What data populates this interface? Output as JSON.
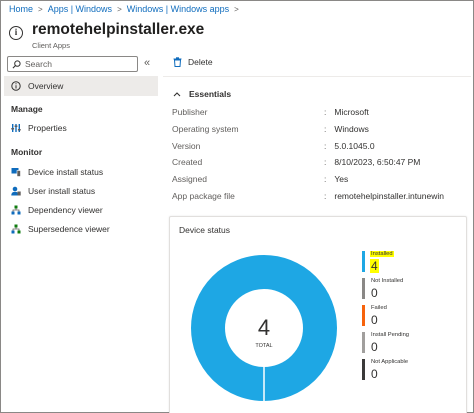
{
  "breadcrumb": [
    "Home",
    "Apps | Windows",
    "Windows | Windows apps"
  ],
  "header": {
    "title": "remotehelpinstaller.exe",
    "subtitle": "Client Apps"
  },
  "search": {
    "placeholder": "Search"
  },
  "sidebar": {
    "overview": "Overview",
    "manage_label": "Manage",
    "properties": "Properties",
    "monitor_label": "Monitor",
    "monitor_items": [
      "Device install status",
      "User install status",
      "Dependency viewer",
      "Supersedence viewer"
    ]
  },
  "toolbar": {
    "delete_label": "Delete"
  },
  "essentials": {
    "heading": "Essentials",
    "rows": [
      {
        "key": "Publisher",
        "value": "Microsoft"
      },
      {
        "key": "Operating system",
        "value": "Windows"
      },
      {
        "key": "Version",
        "value": "5.0.1045.0"
      },
      {
        "key": "Created",
        "value": "8/10/2023, 6:50:47 PM"
      },
      {
        "key": "Assigned",
        "value": "Yes"
      },
      {
        "key": "App package file",
        "value": "remotehelpinstaller.intunewin"
      }
    ]
  },
  "device_status": {
    "title": "Device status",
    "total_value": "4",
    "total_label": "TOTAL",
    "legend": [
      {
        "label": "Installed",
        "value": "4",
        "color": "#1ea7e4",
        "highlight": true
      },
      {
        "label": "Not Installed",
        "value": "0",
        "color": "#8a8886"
      },
      {
        "label": "Failed",
        "value": "0",
        "color": "#f7630c"
      },
      {
        "label": "Install Pending",
        "value": "0",
        "color": "#a19f9d"
      },
      {
        "label": "Not Applicable",
        "value": "0",
        "color": "#3b3a39"
      }
    ]
  },
  "colors": {
    "accent": "#0f6cbd",
    "donut": "#1ea7e4",
    "highlight": "#ffff00"
  }
}
